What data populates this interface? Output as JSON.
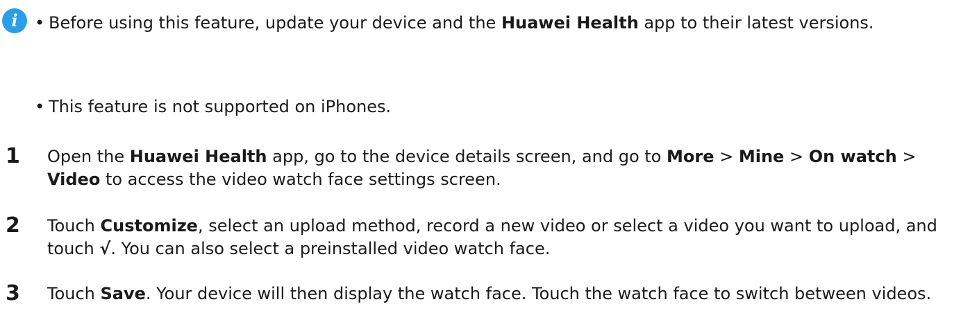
{
  "notes": {
    "icon": "info-icon",
    "icon_color": "#2a9ee6",
    "icon_glyph": "i",
    "bullet": "•",
    "items": [
      {
        "t1": "Before using this feature, update your device and the ",
        "b1": "Huawei Health",
        "t2": " app to their latest versions."
      },
      {
        "t1": "This feature is not supported on iPhones."
      }
    ]
  },
  "steps": [
    {
      "number": "1",
      "t1": "Open the ",
      "b1": "Huawei Health",
      "t2": " app, go to the device details screen, and go to ",
      "b2": "More",
      "t3": " > ",
      "b3": "Mine",
      "t4": " > ",
      "b4": "On watch",
      "t5": " > ",
      "b5": "Video",
      "t6": " to access the video watch face settings screen."
    },
    {
      "number": "2",
      "t1": "Touch ",
      "b1": "Customize",
      "t2": ", select an upload method, record a new video or select a video you want to upload, and touch ",
      "b2": "√",
      "t3": ". You can also select a preinstalled video watch face."
    },
    {
      "number": "3",
      "t1": "Touch ",
      "b1": "Save",
      "t2": ". Your device will then display the watch face. Touch the watch face to switch between videos."
    }
  ]
}
